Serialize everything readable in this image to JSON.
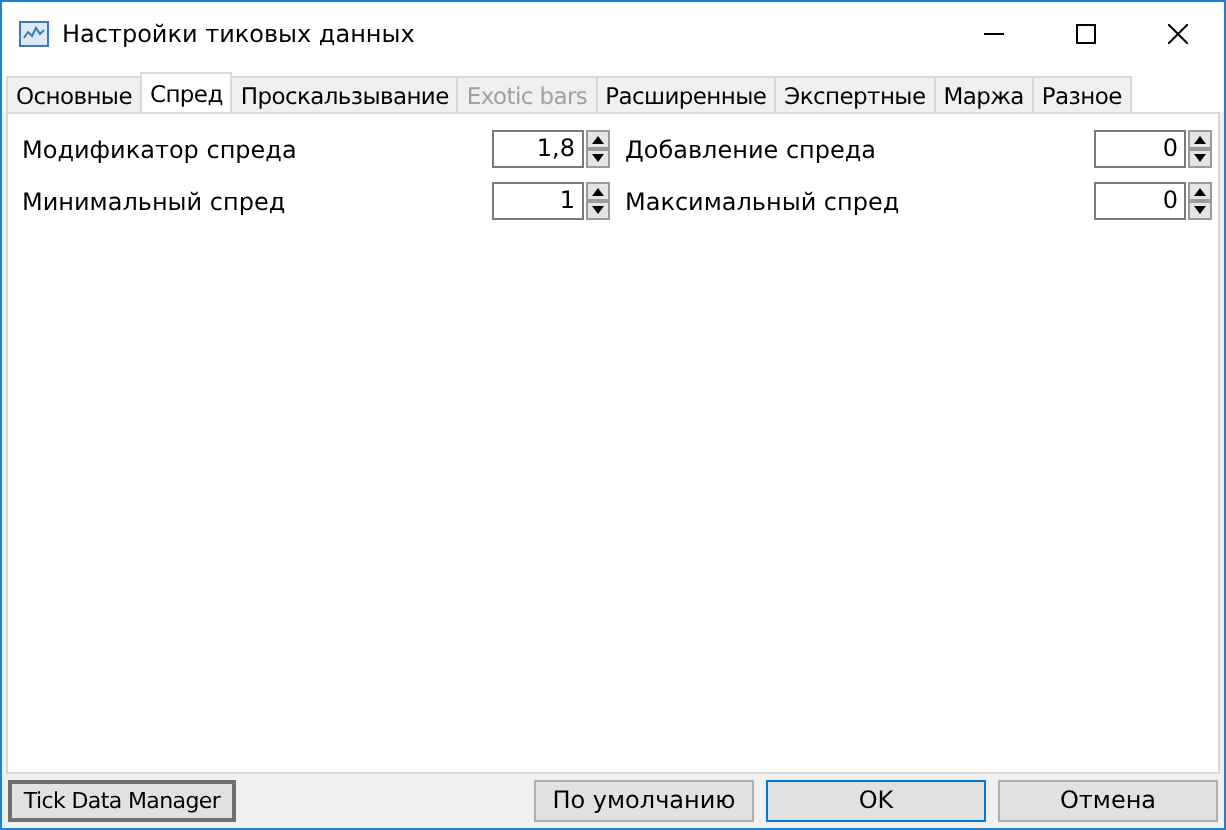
{
  "window": {
    "title": "Настройки тиковых данных"
  },
  "tabs": [
    {
      "label": "Основные",
      "selected": false,
      "disabled": false
    },
    {
      "label": "Спред",
      "selected": true,
      "disabled": false
    },
    {
      "label": "Проскальзывание",
      "selected": false,
      "disabled": false
    },
    {
      "label": "Exotic bars",
      "selected": false,
      "disabled": true
    },
    {
      "label": "Расширенные",
      "selected": false,
      "disabled": false
    },
    {
      "label": "Экспертные",
      "selected": false,
      "disabled": false
    },
    {
      "label": "Маржа",
      "selected": false,
      "disabled": false
    },
    {
      "label": "Разное",
      "selected": false,
      "disabled": false
    }
  ],
  "fields": [
    {
      "label": "Модификатор спреда",
      "value": "1,8"
    },
    {
      "label": "Добавление спреда",
      "value": "0"
    },
    {
      "label": "Минимальный спред",
      "value": "1"
    },
    {
      "label": "Максимальный спред",
      "value": "0"
    }
  ],
  "left_button": "Tick Data Manager",
  "buttons": [
    {
      "label": "По умолчанию",
      "default": false
    },
    {
      "label": "OK",
      "default": true
    },
    {
      "label": "Отмена",
      "default": false
    }
  ]
}
